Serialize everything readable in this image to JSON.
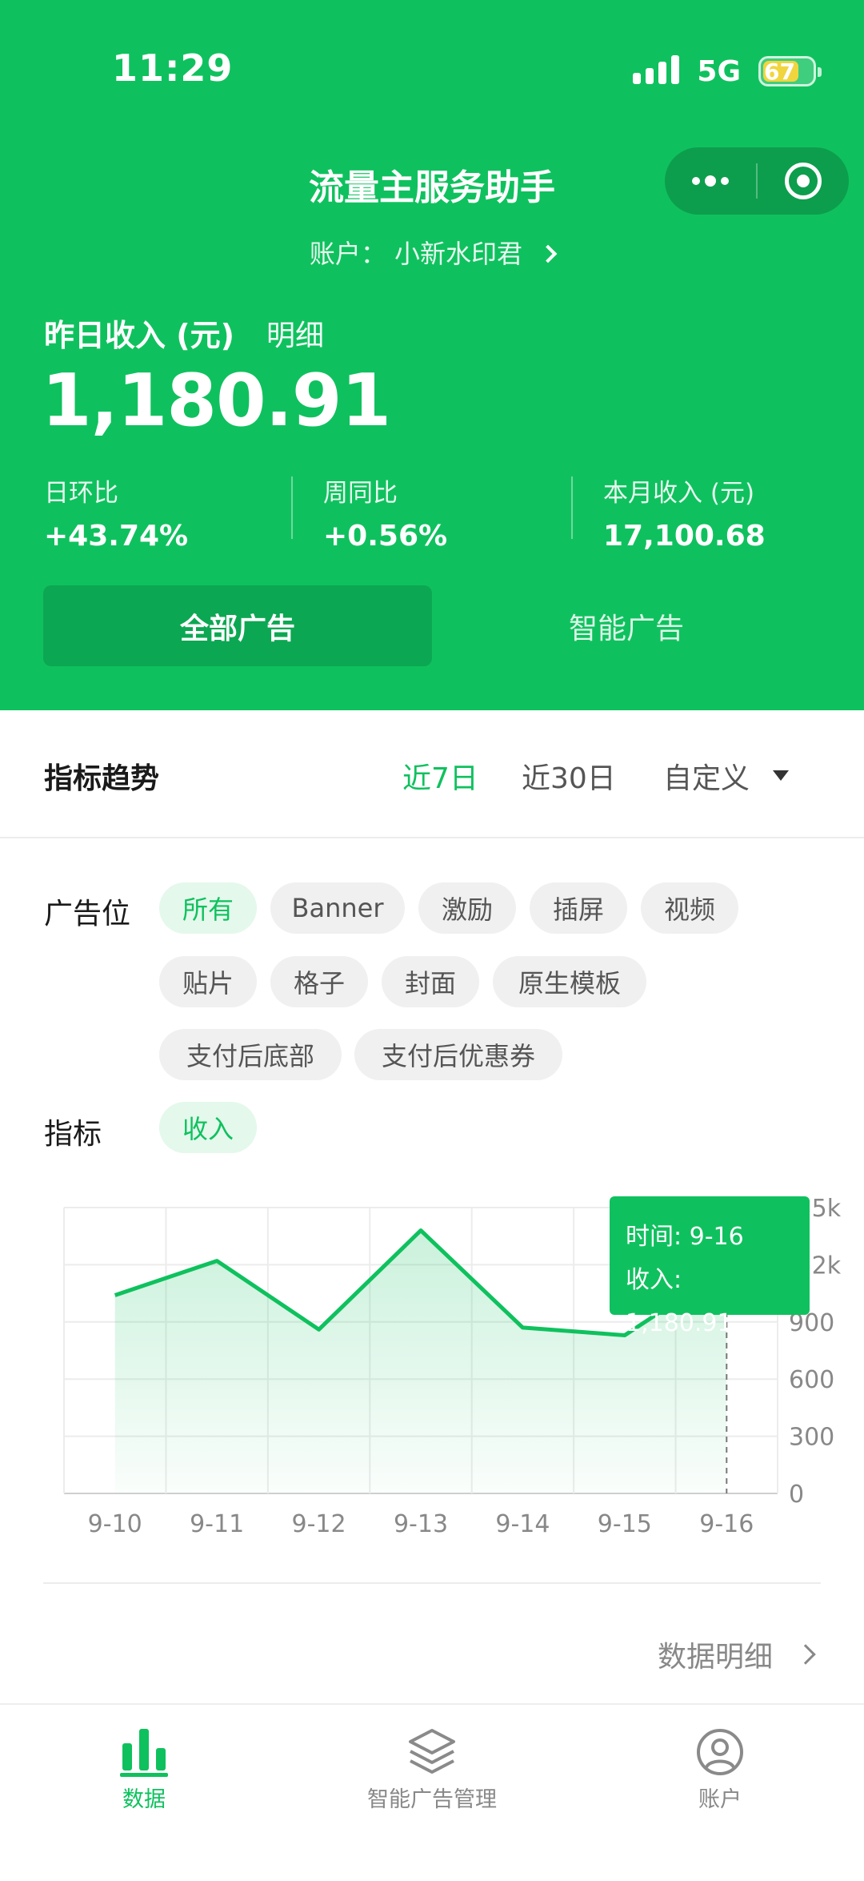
{
  "status_bar": {
    "time": "11:29",
    "network": "5G",
    "battery": "67"
  },
  "header": {
    "title": "流量主服务助手",
    "account_prefix": "账户：",
    "account_name": "小新水印君"
  },
  "income": {
    "label": "昨日收入 (元)",
    "detail_link": "明细",
    "value": "1,180.91",
    "stats": [
      {
        "label": "日环比",
        "value": "+43.74%"
      },
      {
        "label": "周同比",
        "value": "+0.56%"
      },
      {
        "label": "本月收入 (元)",
        "value": "17,100.68"
      }
    ]
  },
  "ad_tabs": [
    {
      "label": "全部广告",
      "active": true
    },
    {
      "label": "智能广告",
      "active": false
    }
  ],
  "trend": {
    "title": "指标趋势",
    "ranges": [
      {
        "label": "近7日",
        "active": true
      },
      {
        "label": "近30日",
        "active": false
      },
      {
        "label": "自定义",
        "active": false
      }
    ]
  },
  "filters": {
    "placement_label": "广告位",
    "placements": [
      "所有",
      "Banner",
      "激励",
      "插屏",
      "视频",
      "贴片",
      "格子",
      "封面",
      "原生模板",
      "支付后底部",
      "支付后优惠券"
    ],
    "active_placement": "所有",
    "metric_label": "指标",
    "metrics": [
      "收入"
    ],
    "active_metric": "收入"
  },
  "chart_data": {
    "type": "area",
    "x": [
      "9-10",
      "9-11",
      "9-12",
      "9-13",
      "9-14",
      "9-15",
      "9-16"
    ],
    "series": [
      {
        "values": [
          1040,
          1220,
          860,
          1380,
          870,
          830,
          1180.91
        ]
      }
    ],
    "y_ticks": [
      "0",
      "300",
      "600",
      "900",
      "1.2k",
      "1.5k"
    ],
    "ylim": [
      0,
      1500
    ],
    "grid": true,
    "line_color": "#0fc15e",
    "tooltip": {
      "time_label": "时间: 9-16",
      "value_label": "收入: 1,180.91"
    }
  },
  "data_detail_link": "数据明细",
  "tabbar": [
    {
      "label": "数据",
      "icon": "bar-chart-icon",
      "active": true
    },
    {
      "label": "智能广告管理",
      "icon": "layers-icon",
      "active": false
    },
    {
      "label": "账户",
      "icon": "user-circle-icon",
      "active": false
    }
  ],
  "colors": {
    "brand_green": "#0fc15e",
    "dark_green": "#0ca752"
  }
}
